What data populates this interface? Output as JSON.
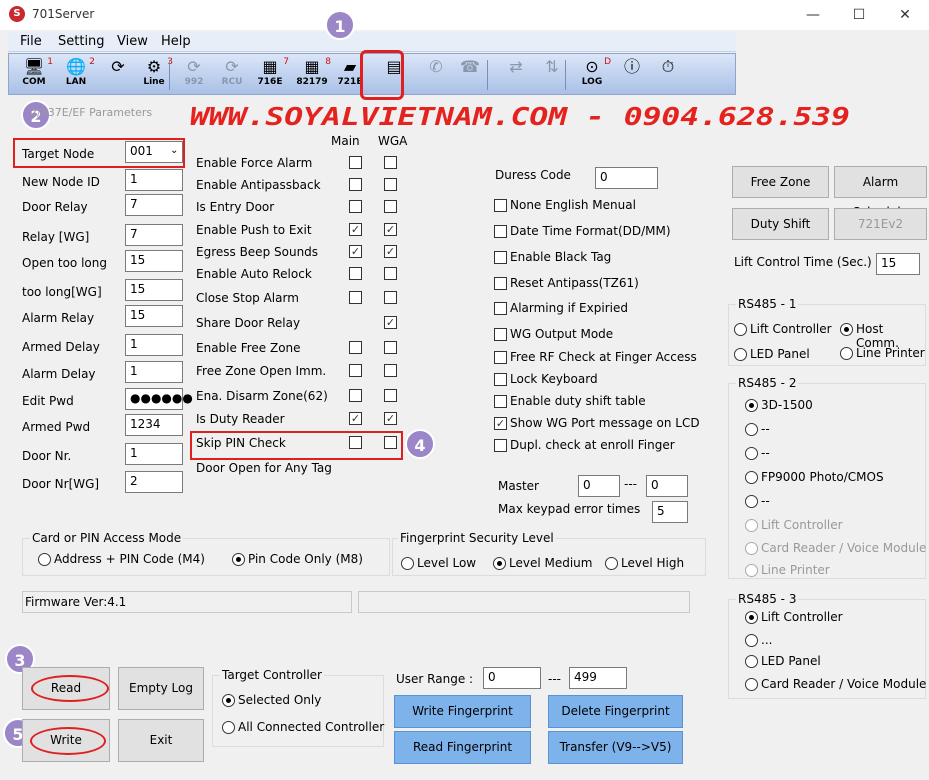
{
  "window": {
    "title": "701Server",
    "min": "—",
    "max": "☐",
    "close": "✕"
  },
  "menu": [
    "File",
    "Setting",
    "View",
    "Help"
  ],
  "toolbar": [
    {
      "icon": "computer-icon",
      "glyph": "🖥",
      "label": "COM",
      "num": "1"
    },
    {
      "icon": "globe-icon",
      "glyph": "🌐",
      "label": "LAN",
      "num": "2"
    },
    {
      "icon": "refresh-icon",
      "glyph": "⟳",
      "label": "",
      "num": ""
    },
    {
      "icon": "line-icon",
      "glyph": "⚙",
      "label": "Line",
      "num": "3"
    },
    {
      "icon": "refresh-992-icon",
      "glyph": "⟳",
      "label": "992",
      "num": ""
    },
    {
      "icon": "refresh-rcu-icon",
      "glyph": "⟳",
      "label": "RCU",
      "num": ""
    },
    {
      "icon": "controller-716e-icon",
      "glyph": "▦",
      "label": "716E",
      "num": "7"
    },
    {
      "icon": "controller-82179-icon",
      "glyph": "▦",
      "label": "82179",
      "num": "8"
    },
    {
      "icon": "reader-721e-icon",
      "glyph": "▰",
      "label": "721E",
      "num": ""
    },
    {
      "icon": "parameters-icon",
      "glyph": "▤",
      "label": "",
      "num": ""
    },
    {
      "icon": "phone-icon",
      "glyph": "✆",
      "label": "",
      "num": ""
    },
    {
      "icon": "hangup-icon",
      "glyph": "☎",
      "label": "",
      "num": ""
    },
    {
      "icon": "link-icon",
      "glyph": "⇄",
      "label": "",
      "num": ""
    },
    {
      "icon": "updown-icon",
      "glyph": "⇅",
      "label": "",
      "num": ""
    },
    {
      "icon": "log-icon",
      "glyph": "⊙",
      "label": "LOG",
      "num": "D"
    },
    {
      "icon": "info-icon",
      "glyph": "ⓘ",
      "label": "",
      "num": ""
    },
    {
      "icon": "clock-download-icon",
      "glyph": "⏱",
      "label": "",
      "num": ""
    }
  ],
  "badges": [
    "1",
    "2",
    "3",
    "4",
    "5"
  ],
  "tab_caption": "2/837E/EF Parameters",
  "watermark": "WWW.SOYALVIETNAM.COM - 0904.628.539",
  "left_fields": [
    {
      "label": "Target Node",
      "value": "001"
    },
    {
      "label": "New Node ID",
      "value": "1"
    },
    {
      "label": "Door Relay",
      "value": "7"
    },
    {
      "label": "Relay [WG]",
      "value": "7"
    },
    {
      "label": "Open too long",
      "value": "15"
    },
    {
      "label": "too long[WG]",
      "value": "15"
    },
    {
      "label": "Alarm Relay",
      "value": "15"
    },
    {
      "label": "Armed Delay",
      "value": "1"
    },
    {
      "label": "Alarm Delay",
      "value": "1"
    },
    {
      "label": "Edit Pwd",
      "value": "●●●●●●"
    },
    {
      "label": "Armed Pwd",
      "value": "1234"
    },
    {
      "label": "Door Nr.",
      "value": "1"
    },
    {
      "label": "Door Nr[WG]",
      "value": "2"
    }
  ],
  "col_main": "Main",
  "col_wga": "WGA",
  "options": [
    {
      "label": "Enable Force Alarm",
      "main": false,
      "wga": false
    },
    {
      "label": "Enable Antipassback",
      "main": false,
      "wga": false
    },
    {
      "label": "Is Entry Door",
      "main": false,
      "wga": false
    },
    {
      "label": "Enable Push to Exit",
      "main": true,
      "wga": true
    },
    {
      "label": "Egress Beep Sounds",
      "main": true,
      "wga": true
    },
    {
      "label": "Enable Auto Relock",
      "main": false,
      "wga": false
    },
    {
      "label": "Close Stop Alarm",
      "main": false,
      "wga": false
    },
    {
      "label": "Share Door Relay",
      "main": null,
      "wga": true
    },
    {
      "label": "Enable Free Zone",
      "main": false,
      "wga": false
    },
    {
      "label": "Free Zone Open Imm.",
      "main": false,
      "wga": false
    },
    {
      "label": "Ena. Disarm Zone(62)",
      "main": false,
      "wga": false
    },
    {
      "label": "Is Duty Reader",
      "main": true,
      "wga": true
    },
    {
      "label": "Skip PIN Check",
      "main": false,
      "wga": false
    },
    {
      "label": "Door Open for Any Tag",
      "main": null,
      "wga": null
    }
  ],
  "duress": {
    "label": "Duress Code",
    "value": "0"
  },
  "mid_checks": [
    {
      "label": "None English Menual",
      "checked": false
    },
    {
      "label": "Date Time Format(DD/MM)",
      "checked": false
    },
    {
      "label": "Enable Black Tag",
      "checked": false
    },
    {
      "label": "Reset Antipass(TZ61)",
      "checked": false
    },
    {
      "label": "Alarming if Expiried",
      "checked": false
    },
    {
      "label": "WG Output Mode",
      "checked": false
    },
    {
      "label": "Free RF Check at Finger Access",
      "checked": false
    },
    {
      "label": "Lock Keyboard",
      "checked": false
    },
    {
      "label": "Enable duty shift table",
      "checked": false
    },
    {
      "label": "Show WG Port message on LCD",
      "checked": true
    },
    {
      "label": "Dupl. check at enroll  Finger",
      "checked": false
    }
  ],
  "master": {
    "label": "Master",
    "from": "0",
    "sep": "---",
    "to": "0"
  },
  "max_keypad": {
    "label": "Max keypad error times",
    "value": "5"
  },
  "right_buttons": {
    "free_zone": "Free Zone",
    "alarm_schedule": "Alarm Schedule",
    "duty_shift": "Duty Shift",
    "v721": "721Ev2"
  },
  "lift_time": {
    "label": "Lift Control Time (Sec.)",
    "value": "15"
  },
  "rs485_1": {
    "title": "RS485 - 1",
    "opts": [
      {
        "label": "Lift Controller",
        "on": false
      },
      {
        "label": "Host Comm.",
        "on": true
      },
      {
        "label": "LED Panel",
        "on": false
      },
      {
        "label": "Line Printer",
        "on": false
      }
    ]
  },
  "rs485_2": {
    "title": "RS485 - 2",
    "opts": [
      {
        "label": "3D-1500",
        "on": true,
        "dis": false
      },
      {
        "label": "--",
        "on": false,
        "dis": false
      },
      {
        "label": "--",
        "on": false,
        "dis": false
      },
      {
        "label": "FP9000 Photo/CMOS",
        "on": false,
        "dis": false
      },
      {
        "label": "--",
        "on": false,
        "dis": false
      },
      {
        "label": "Lift Controller",
        "on": false,
        "dis": true
      },
      {
        "label": "Card Reader / Voice Module",
        "on": false,
        "dis": true
      },
      {
        "label": "Line Printer",
        "on": false,
        "dis": true
      }
    ]
  },
  "rs485_3": {
    "title": "RS485 - 3",
    "opts": [
      {
        "label": "Lift Controller",
        "on": true
      },
      {
        "label": "...",
        "on": false
      },
      {
        "label": "LED Panel",
        "on": false
      },
      {
        "label": "Card Reader / Voice Module",
        "on": false
      }
    ]
  },
  "access_mode": {
    "title": "Card or PIN Access Mode",
    "opts": [
      {
        "label": "Address + PIN Code (M4)",
        "on": false
      },
      {
        "label": "Pin Code Only (M8)",
        "on": true
      }
    ]
  },
  "fp_level": {
    "title": "Fingerprint Security Level",
    "opts": [
      {
        "label": "Level Low",
        "on": false
      },
      {
        "label": "Level Medium",
        "on": true
      },
      {
        "label": "Level High",
        "on": false
      }
    ]
  },
  "firmware": "Firmware Ver:4.1",
  "buttons": {
    "read": "Read",
    "empty_log": "Empty Log",
    "write": "Write",
    "exit": "Exit"
  },
  "target_ctrl": {
    "title": "Target Controller",
    "opts": [
      {
        "label": "Selected Only",
        "on": true
      },
      {
        "label": "All Connected Controller",
        "on": false
      }
    ]
  },
  "user_range": {
    "label": "User Range :",
    "from": "0",
    "sep": "---",
    "to": "499"
  },
  "fp_buttons": {
    "write": "Write Fingerprint",
    "delete": "Delete Fingerprint",
    "read": "Read Fingerprint",
    "transfer": "Transfer (V9-->V5)"
  },
  "colors": {
    "highlight": "#e02020",
    "badge": "#9b86c8",
    "button_blue": "#7eb2ea",
    "watermark": "#e4231f"
  }
}
